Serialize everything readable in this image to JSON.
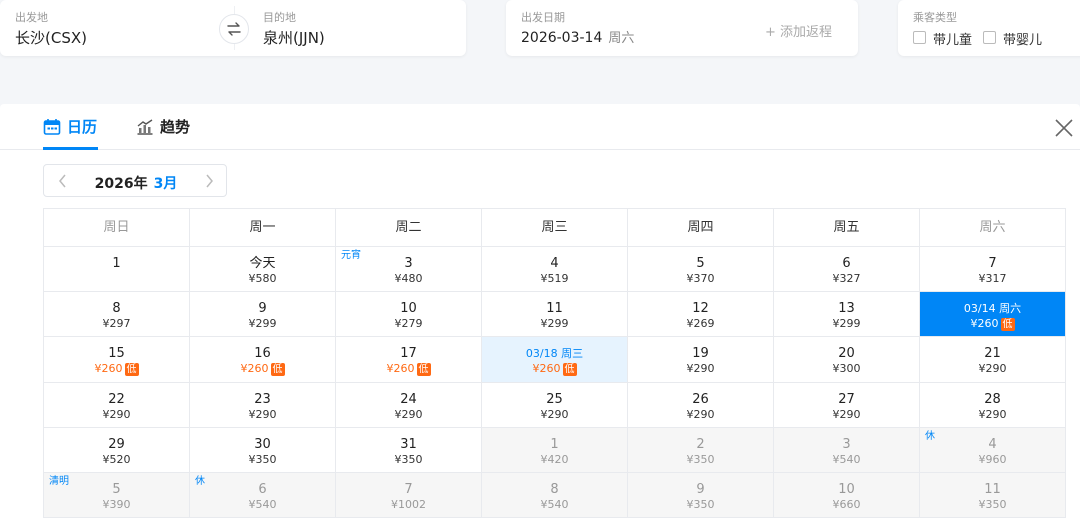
{
  "search": {
    "from_label": "出发地",
    "from_value": "长沙(CSX)",
    "to_label": "目的地",
    "to_value": "泉州(JJN)",
    "date_label": "出发日期",
    "date_value": "2026-03-14",
    "date_weekday": "周六",
    "add_return": "+ 添加返程",
    "pax_label": "乘客类型",
    "child_label": "带儿童",
    "infant_label": "带婴儿"
  },
  "tabs": [
    {
      "label": "日历",
      "active": true
    },
    {
      "label": "趋势",
      "active": false
    }
  ],
  "month_nav": {
    "year": "2026年",
    "month": "3月"
  },
  "weekdays": [
    "周日",
    "周一",
    "周二",
    "周三",
    "周四",
    "周五",
    "周六"
  ],
  "colors": {
    "accent": "#0086f6",
    "low_price": "#ff6913"
  },
  "weeks": [
    [
      {
        "day": "1",
        "price": ""
      },
      {
        "day": "今天",
        "price": "¥580"
      },
      {
        "day": "3",
        "price": "¥480",
        "badge": "元宵"
      },
      {
        "day": "4",
        "price": "¥519"
      },
      {
        "day": "5",
        "price": "¥370"
      },
      {
        "day": "6",
        "price": "¥327"
      },
      {
        "day": "7",
        "price": "¥317"
      }
    ],
    [
      {
        "day": "8",
        "price": "¥297"
      },
      {
        "day": "9",
        "price": "¥299"
      },
      {
        "day": "10",
        "price": "¥279"
      },
      {
        "day": "11",
        "price": "¥299"
      },
      {
        "day": "12",
        "price": "¥269"
      },
      {
        "day": "13",
        "price": "¥299"
      },
      {
        "day": "03/14 周六",
        "price": "¥260",
        "low": "低",
        "state": "sel"
      }
    ],
    [
      {
        "day": "15",
        "price": "¥260",
        "low": "低"
      },
      {
        "day": "16",
        "price": "¥260",
        "low": "低"
      },
      {
        "day": "17",
        "price": "¥260",
        "low": "低"
      },
      {
        "day": "03/18 周三",
        "price": "¥260",
        "low": "低",
        "state": "ret"
      },
      {
        "day": "19",
        "price": "¥290"
      },
      {
        "day": "20",
        "price": "¥300"
      },
      {
        "day": "21",
        "price": "¥290"
      }
    ],
    [
      {
        "day": "22",
        "price": "¥290"
      },
      {
        "day": "23",
        "price": "¥290"
      },
      {
        "day": "24",
        "price": "¥290"
      },
      {
        "day": "25",
        "price": "¥290"
      },
      {
        "day": "26",
        "price": "¥290"
      },
      {
        "day": "27",
        "price": "¥290"
      },
      {
        "day": "28",
        "price": "¥290"
      }
    ],
    [
      {
        "day": "29",
        "price": "¥520"
      },
      {
        "day": "30",
        "price": "¥350"
      },
      {
        "day": "31",
        "price": "¥350"
      },
      {
        "day": "1",
        "price": "¥420",
        "state": "outm"
      },
      {
        "day": "2",
        "price": "¥350",
        "state": "outm"
      },
      {
        "day": "3",
        "price": "¥540",
        "state": "outm"
      },
      {
        "day": "4",
        "price": "¥960",
        "state": "outm",
        "badge": "休"
      }
    ],
    [
      {
        "day": "5",
        "price": "¥390",
        "state": "outm",
        "badge": "清明"
      },
      {
        "day": "6",
        "price": "¥540",
        "state": "outm",
        "badge": "休"
      },
      {
        "day": "7",
        "price": "¥1002",
        "state": "outm"
      },
      {
        "day": "8",
        "price": "¥540",
        "state": "outm"
      },
      {
        "day": "9",
        "price": "¥350",
        "state": "outm"
      },
      {
        "day": "10",
        "price": "¥660",
        "state": "outm"
      },
      {
        "day": "11",
        "price": "¥350",
        "state": "outm"
      }
    ]
  ]
}
